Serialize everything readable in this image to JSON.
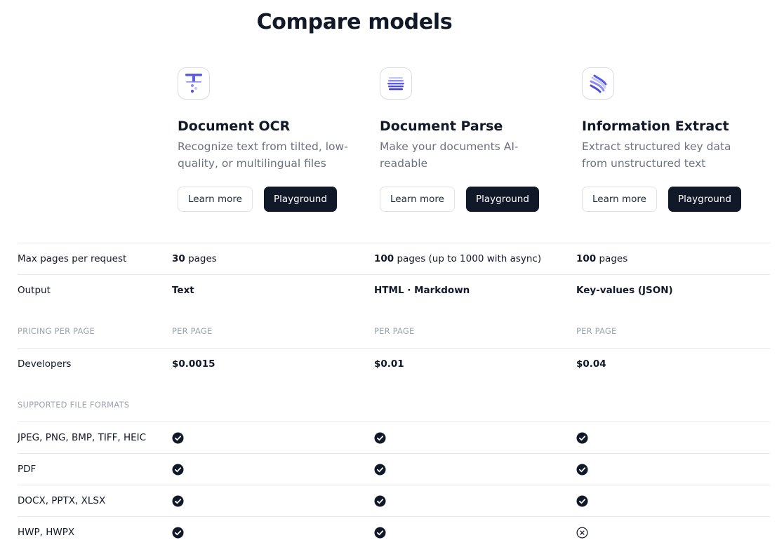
{
  "page": {
    "title": "Compare models"
  },
  "models": [
    {
      "logo_icon": "document-ocr-logo-icon",
      "name": "Document OCR",
      "description": "Recognize text from tilted, low-quality, or multilingual files",
      "learn_more": "Learn more",
      "playground": "Playground"
    },
    {
      "logo_icon": "document-parse-logo-icon",
      "name": "Document Parse",
      "description": "Make your documents AI-readable",
      "learn_more": "Learn more",
      "playground": "Playground"
    },
    {
      "logo_icon": "information-extract-logo-icon",
      "name": "Information Extract",
      "description": "Extract structured key data from unstructured text",
      "learn_more": "Learn more",
      "playground": "Playground"
    }
  ],
  "specs": {
    "max_pages": {
      "label": "Max pages per request",
      "values": [
        {
          "num": "30",
          "rest": " pages"
        },
        {
          "num": "100",
          "rest": " pages (up to 1000 with async)"
        },
        {
          "num": "100",
          "rest": " pages"
        }
      ]
    },
    "output": {
      "label": "Output",
      "values": [
        "Text",
        "HTML · Markdown",
        "Key-values (JSON)"
      ]
    }
  },
  "pricing": {
    "heading": "PRICING PER PAGE",
    "column_heading": "PER PAGE",
    "developers": {
      "label": "Developers",
      "values": [
        "$0.0015",
        "$0.01",
        "$0.04"
      ]
    }
  },
  "formats": {
    "heading": "SUPPORTED FILE FORMATS",
    "rows": [
      {
        "label": "JPEG, PNG, BMP, TIFF, HEIC",
        "support": [
          true,
          true,
          true
        ]
      },
      {
        "label": "PDF",
        "support": [
          true,
          true,
          true
        ]
      },
      {
        "label": "DOCX, PPTX, XLSX",
        "support": [
          true,
          true,
          true
        ]
      },
      {
        "label": "HWP, HWPX",
        "support": [
          true,
          true,
          false
        ]
      }
    ]
  },
  "colors": {
    "dark": "#111827",
    "muted": "#6b7280",
    "section": "#9ca3af",
    "border": "#e5e7eb",
    "logo_accent": "#5b5ce6"
  }
}
